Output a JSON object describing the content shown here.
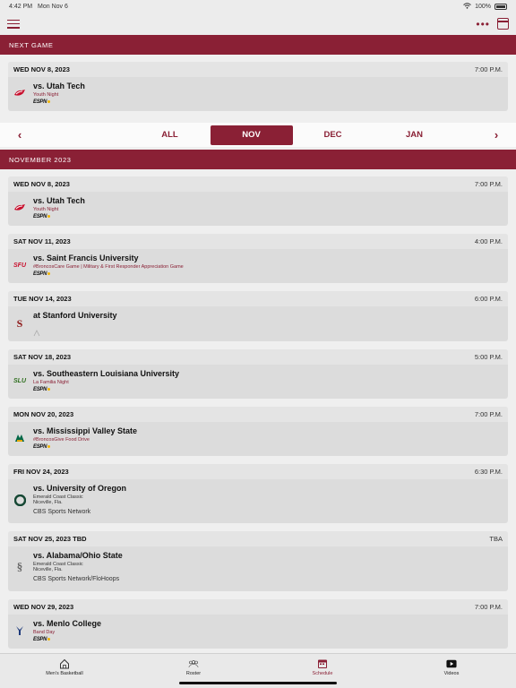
{
  "status": {
    "time": "4:42 PM",
    "date": "Mon Nov 6",
    "battery": "100%"
  },
  "icons": {
    "menu": "menu-icon",
    "more": "more-icon",
    "calendar": "calendar-icon"
  },
  "colors": {
    "brand": "#8a2035",
    "gold": "#f0b400"
  },
  "next_game": {
    "header": "NEXT GAME",
    "date": "WED NOV 8, 2023",
    "time": "7:00 P.M.",
    "opponent": "vs. Utah Tech",
    "promo": "Youth Night",
    "network": "ESPN+"
  },
  "month_tabs": {
    "items": [
      "ALL",
      "NOV",
      "DEC",
      "JAN"
    ],
    "selected": "NOV",
    "prev_icon": "chevron-left-icon",
    "next_icon": "chevron-right-icon"
  },
  "month_header": "NOVEMBER 2023",
  "games": [
    {
      "date": "WED NOV 8, 2023",
      "time": "7:00 P.M.",
      "opponent": "vs. Utah Tech",
      "promo": "Youth Night",
      "network": "ESPN+"
    },
    {
      "date": "SAT NOV 11, 2023",
      "time": "4:00 P.M.",
      "opponent": "vs. Saint Francis University",
      "promo": "#BroncosCare Game | Military & First Responder Appreciation Game",
      "network": "ESPN+"
    },
    {
      "date": "TUE NOV 14, 2023",
      "time": "6:00 P.M.",
      "opponent": "at Stanford University",
      "promo": "",
      "network": ""
    },
    {
      "date": "SAT NOV 18, 2023",
      "time": "5:00 P.M.",
      "opponent": "vs. Southeastern Louisiana University",
      "promo": "La Familia Night",
      "network": "ESPN+"
    },
    {
      "date": "MON NOV 20, 2023",
      "time": "7:00 P.M.",
      "opponent": "vs. Mississippi Valley State",
      "promo": "#BroncosGive Food Drive",
      "network": "ESPN+"
    },
    {
      "date": "FRI NOV 24, 2023",
      "time": "6:30 P.M.",
      "opponent": "vs. University of Oregon",
      "event": "Emerald Coast Classic",
      "location": "Niceville, Fla.",
      "tv": "CBS Sports Network"
    },
    {
      "date": "SAT NOV 25, 2023 TBD",
      "time": "TBA",
      "opponent": "vs. Alabama/Ohio State",
      "event": "Emerald Coast Classic",
      "location": "Niceville, Fla.",
      "tv": "CBS Sports Network/FloHoops"
    },
    {
      "date": "WED NOV 29, 2023",
      "time": "7:00 P.M.",
      "opponent": "vs. Menlo College",
      "promo": "Band Day",
      "network": "ESPN+"
    }
  ],
  "bottom_nav": [
    {
      "label": "Men's Basketball",
      "icon": "home-icon"
    },
    {
      "label": "Roster",
      "icon": "roster-icon"
    },
    {
      "label": "Schedule",
      "icon": "calendar-icon"
    },
    {
      "label": "Videos",
      "icon": "play-icon"
    }
  ]
}
